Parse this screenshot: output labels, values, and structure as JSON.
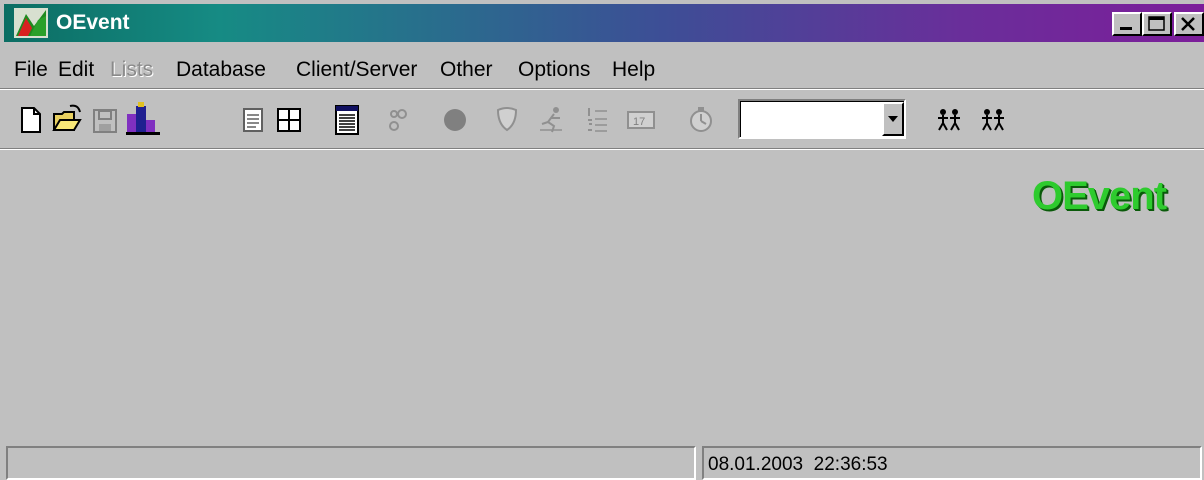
{
  "window": {
    "title": "OEvent",
    "controls": {
      "minimize": "minimize",
      "maximize": "maximize",
      "close": "close"
    }
  },
  "menu": {
    "items": [
      {
        "label": "File",
        "enabled": true
      },
      {
        "label": "Edit",
        "enabled": true
      },
      {
        "label": "Lists",
        "enabled": false
      },
      {
        "label": "Database",
        "enabled": true
      },
      {
        "label": "Client/Server",
        "enabled": true
      },
      {
        "label": "Other",
        "enabled": true
      },
      {
        "label": "Options",
        "enabled": true
      },
      {
        "label": "Help",
        "enabled": true
      }
    ]
  },
  "toolbar": {
    "buttons": [
      {
        "icon": "new-document-icon",
        "enabled": true
      },
      {
        "icon": "open-folder-icon",
        "enabled": true
      },
      {
        "icon": "save-disk-icon",
        "enabled": false
      },
      {
        "icon": "podium-icon",
        "enabled": true
      },
      {
        "icon": "form-document-icon",
        "enabled": true
      },
      {
        "icon": "grid-table-icon",
        "enabled": true
      },
      {
        "icon": "list-report-icon",
        "enabled": true
      },
      {
        "icon": "controls-icon",
        "enabled": false
      },
      {
        "icon": "circle-icon",
        "enabled": false
      },
      {
        "icon": "shield-icon",
        "enabled": false
      },
      {
        "icon": "runner-icon",
        "enabled": false
      },
      {
        "icon": "numbered-list-icon",
        "enabled": false
      },
      {
        "icon": "calendar-icon",
        "enabled": false
      },
      {
        "icon": "stopwatch-icon",
        "enabled": false
      },
      {
        "icon": "teams-icon",
        "enabled": true
      },
      {
        "icon": "relay-teams-icon",
        "enabled": true
      }
    ],
    "combo": {
      "value": "",
      "arrow_icon": "dropdown-arrow-icon"
    }
  },
  "logo": {
    "text": "OEvent",
    "color": "#2ecb2e"
  },
  "statusbar": {
    "left": "",
    "datetime": "08.01.2003  22:36:53"
  }
}
